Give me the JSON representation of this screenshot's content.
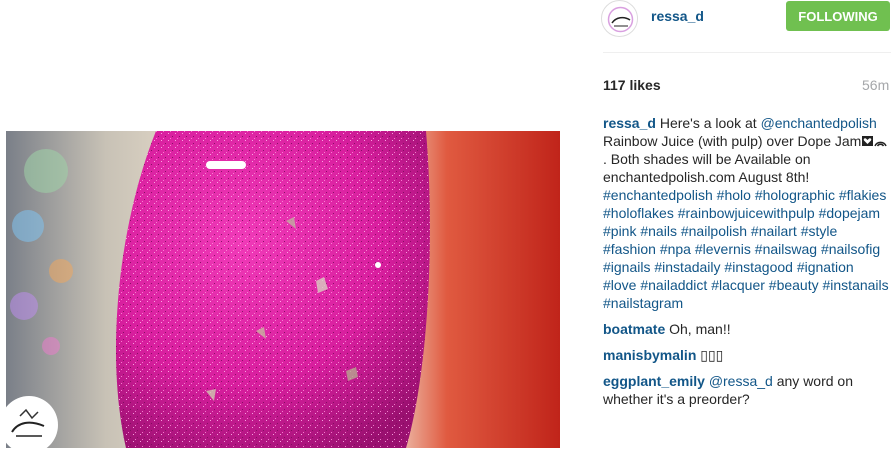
{
  "post": {
    "username": "ressa_d",
    "follow_label": "FOLLOWING",
    "likes": "117 likes",
    "time": "56m"
  },
  "caption": {
    "user": "ressa_d",
    "t1": " Here's a look at ",
    "mention": "@enchantedpolish",
    "t2": " Rainbow Juice (with pulp) over Dope Jam",
    "t3": ". Both shades will be Available on enchantedpolish.com August 8th!",
    "hashtags": [
      "#enchantedpolish",
      "#holo",
      "#holographic",
      "#flakies",
      "#holoflakes",
      "#rainbowjuicewithpulp",
      "#dopejam",
      "#pink",
      "#nails",
      "#nailpolish",
      "#nailart",
      "#style",
      "#fashion",
      "#npa",
      "#levernis",
      "#nailswag",
      "#nailsofig",
      "#ignails",
      "#instadaily",
      "#instagood",
      "#ignation",
      "#love",
      "#nailaddict",
      "#lacquer",
      "#beauty",
      "#instanails",
      "#nailstagram"
    ]
  },
  "comments": [
    {
      "user": "boatmate",
      "text": "Oh, man!!"
    },
    {
      "user": "manisbymalin",
      "text": "▯▯▯"
    },
    {
      "user": "eggplant_emily",
      "mention": "@ressa_d",
      "text": " any word on whether it's a preorder?"
    }
  ],
  "icons": {
    "avatar": "avatar-logo-icon",
    "watermark": "watermark-logo-icon",
    "emoji": "heart-rainbow-emoji-icon"
  }
}
